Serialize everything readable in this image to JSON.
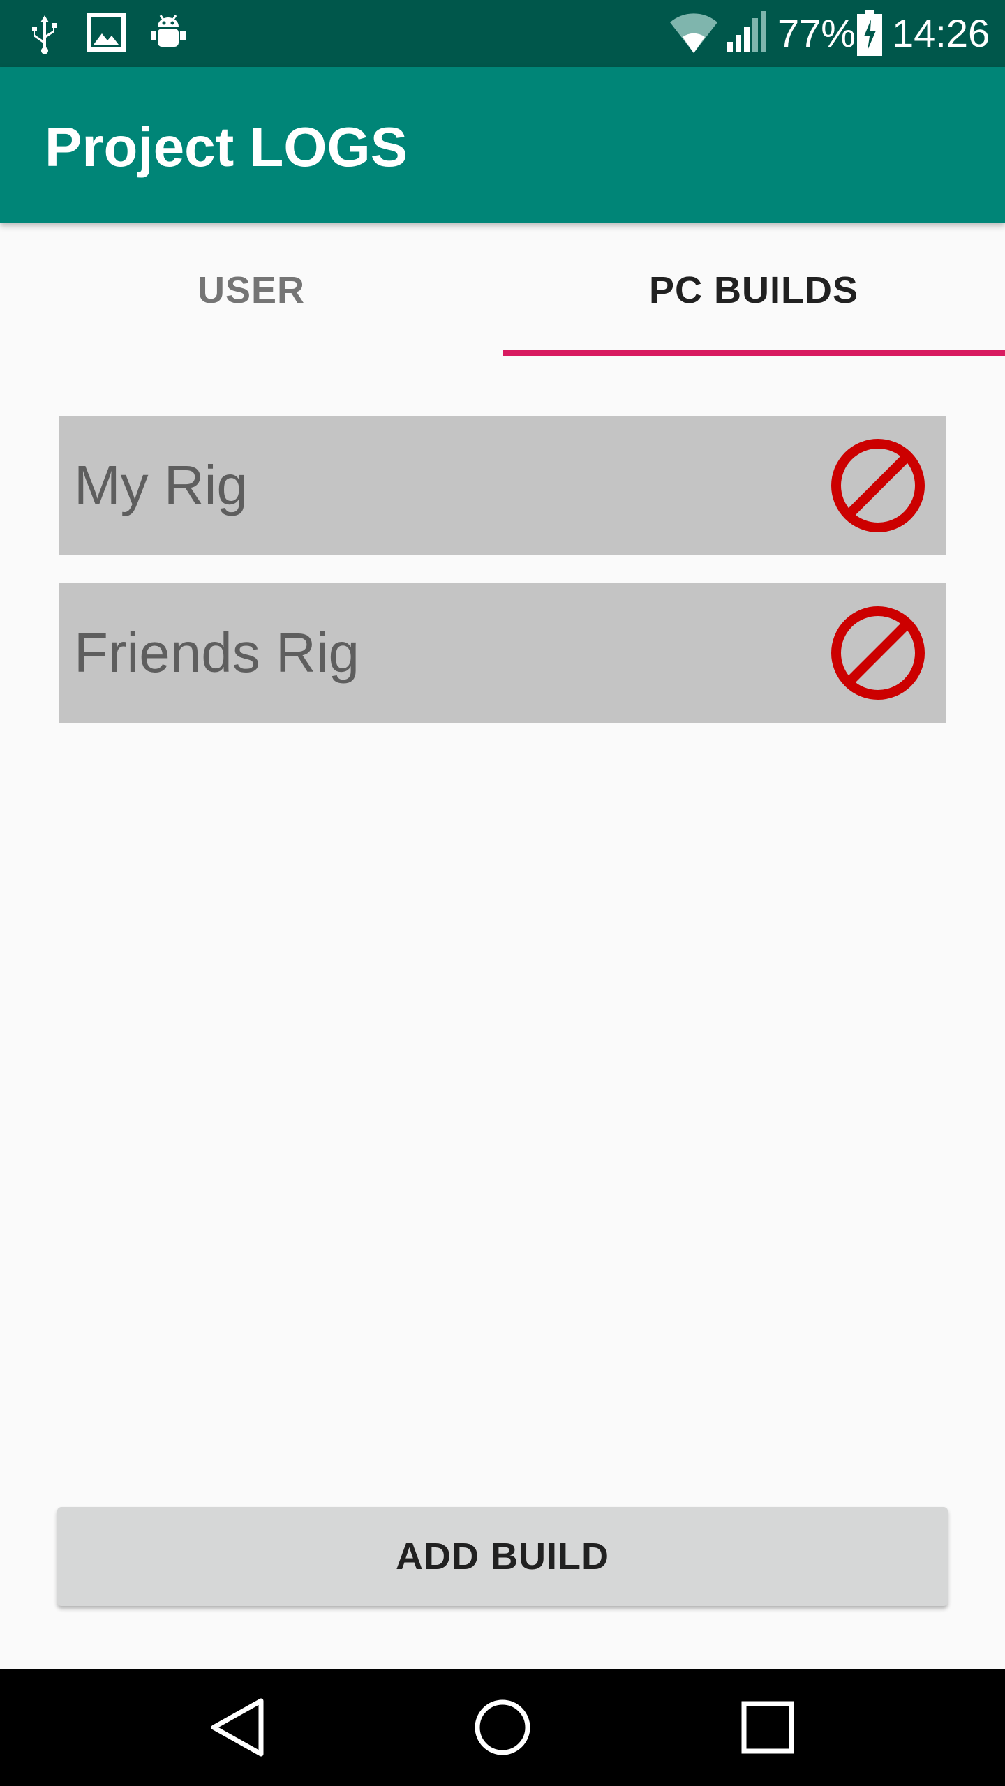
{
  "status_bar": {
    "battery_percent": "77%",
    "time": "14:26",
    "icons": [
      "usb-icon",
      "image-icon",
      "android-debug-icon",
      "wifi-icon",
      "signal-icon",
      "battery-charging-icon"
    ]
  },
  "app_bar": {
    "title": "Project LOGS"
  },
  "tabs": [
    {
      "label": "USER",
      "selected": false
    },
    {
      "label": "PC BUILDS",
      "selected": true
    }
  ],
  "builds": [
    {
      "name": "My Rig",
      "action_icon": "delete-icon"
    },
    {
      "name": "Friends Rig",
      "action_icon": "delete-icon"
    }
  ],
  "add_build": {
    "label": "ADD BUILD"
  },
  "nav_bar": {
    "icons": [
      "back-icon",
      "home-icon",
      "recents-icon"
    ]
  },
  "colors": {
    "status_bar": "#00574b",
    "app_bar": "#008577",
    "tab_indicator": "#d81b60",
    "list_item_bg": "#c4c4c4",
    "delete_red": "#cc0000",
    "button_bg": "#d6d7d7"
  }
}
